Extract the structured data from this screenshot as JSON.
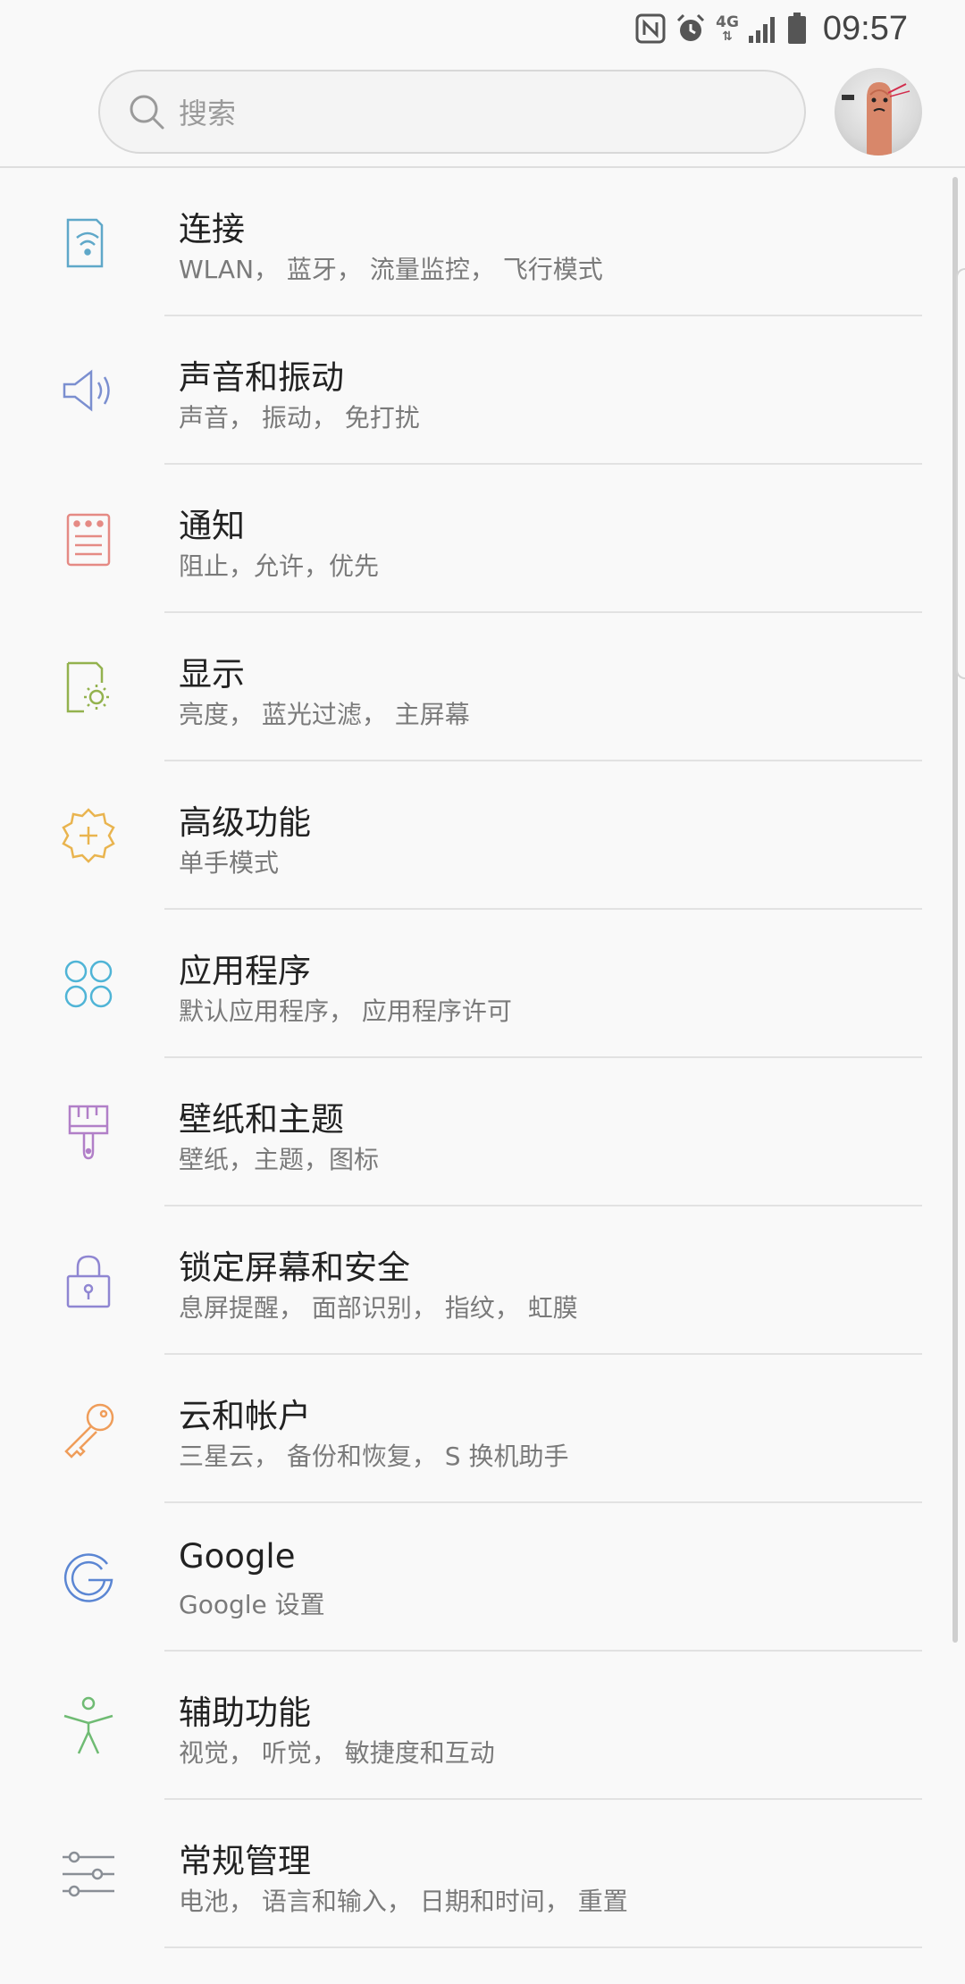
{
  "status_bar": {
    "time": "09:57",
    "network": "4G",
    "icons": [
      "nfc-icon",
      "alarm-icon",
      "signal-icon",
      "battery-icon"
    ]
  },
  "search": {
    "placeholder": "搜索"
  },
  "settings": [
    {
      "title": "连接",
      "subtitle": "WLAN， 蓝牙， 流量监控， 飞行模式",
      "icon": "connections-icon",
      "color": "#5fa8c9"
    },
    {
      "title": "声音和振动",
      "subtitle": "声音， 振动， 免打扰",
      "icon": "speaker-icon",
      "color": "#7b8fd0"
    },
    {
      "title": "通知",
      "subtitle": "阻止，允许，优先",
      "icon": "notification-icon",
      "color": "#e58a84"
    },
    {
      "title": "显示",
      "subtitle": "亮度， 蓝光过滤， 主屏幕",
      "icon": "display-brightness-icon",
      "color": "#93b24e"
    },
    {
      "title": "高级功能",
      "subtitle": "单手模式",
      "icon": "advanced-gear-plus-icon",
      "color": "#e9b44f"
    },
    {
      "title": "应用程序",
      "subtitle": "默认应用程序， 应用程序许可",
      "icon": "apps-grid-icon",
      "color": "#4fb4d6"
    },
    {
      "title": "壁纸和主题",
      "subtitle": "壁纸，主题，图标",
      "icon": "paintbrush-icon",
      "color": "#b17fc8"
    },
    {
      "title": "锁定屏幕和安全",
      "subtitle": "息屏提醒， 面部识别， 指纹， 虹膜",
      "icon": "lock-icon",
      "color": "#8f86d2"
    },
    {
      "title": "云和帐户",
      "subtitle": "三星云， 备份和恢复， S 换机助手",
      "icon": "key-icon",
      "color": "#ef9d5a"
    },
    {
      "title": "Google",
      "subtitle": "Google 设置",
      "icon": "google-icon",
      "color": "#5b86d3"
    },
    {
      "title": "辅助功能",
      "subtitle": "视觉， 听觉， 敏捷度和互动",
      "icon": "accessibility-icon",
      "color": "#6fbb73"
    },
    {
      "title": "常规管理",
      "subtitle": "电池， 语言和输入， 日期和时间， 重置",
      "icon": "sliders-icon",
      "color": "#8a8f96"
    }
  ]
}
